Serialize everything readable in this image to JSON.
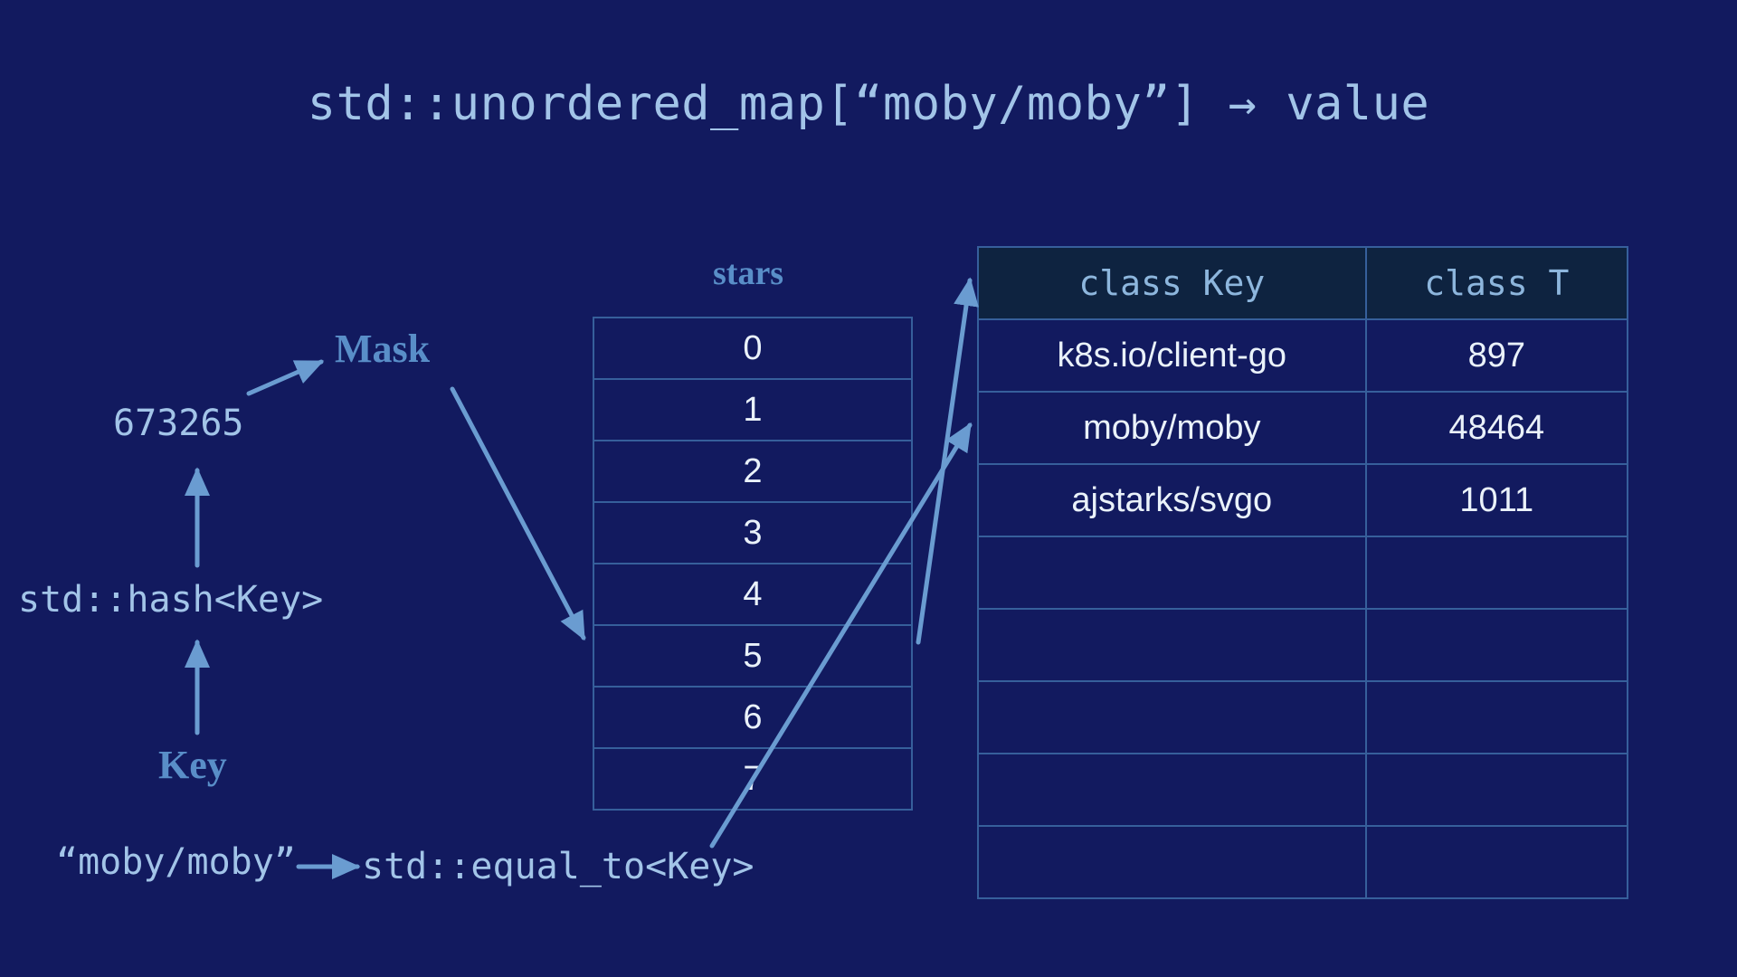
{
  "title": "std::unordered_map[“moby/moby”] → value",
  "key_label": "Key",
  "key_value": "“moby/moby”",
  "hash_label": "std::hash<Key>",
  "hash_value": "673265",
  "mask_label": "Mask",
  "stars_label": "stars",
  "equal_to_label": "std::equal_to<Key>",
  "buckets": [
    "0",
    "1",
    "2",
    "3",
    "4",
    "5",
    "6",
    "7"
  ],
  "kv": {
    "header_key": "class Key",
    "header_val": "class T",
    "rows": [
      {
        "key": "k8s.io/client-go",
        "val": "897"
      },
      {
        "key": "moby/moby",
        "val": "48464"
      },
      {
        "key": "ajstarks/svgo",
        "val": "1011"
      },
      {
        "key": "",
        "val": ""
      },
      {
        "key": "",
        "val": ""
      },
      {
        "key": "",
        "val": ""
      },
      {
        "key": "",
        "val": ""
      },
      {
        "key": "",
        "val": ""
      }
    ]
  },
  "colors": {
    "bg": "#121a5f",
    "mono": "#a2c4e8",
    "hand": "#598ec8",
    "cell_text": "#eaf2fa",
    "border": "#365f9b",
    "th_bg": "#0e2340",
    "arrow": "#6a9cd1"
  }
}
